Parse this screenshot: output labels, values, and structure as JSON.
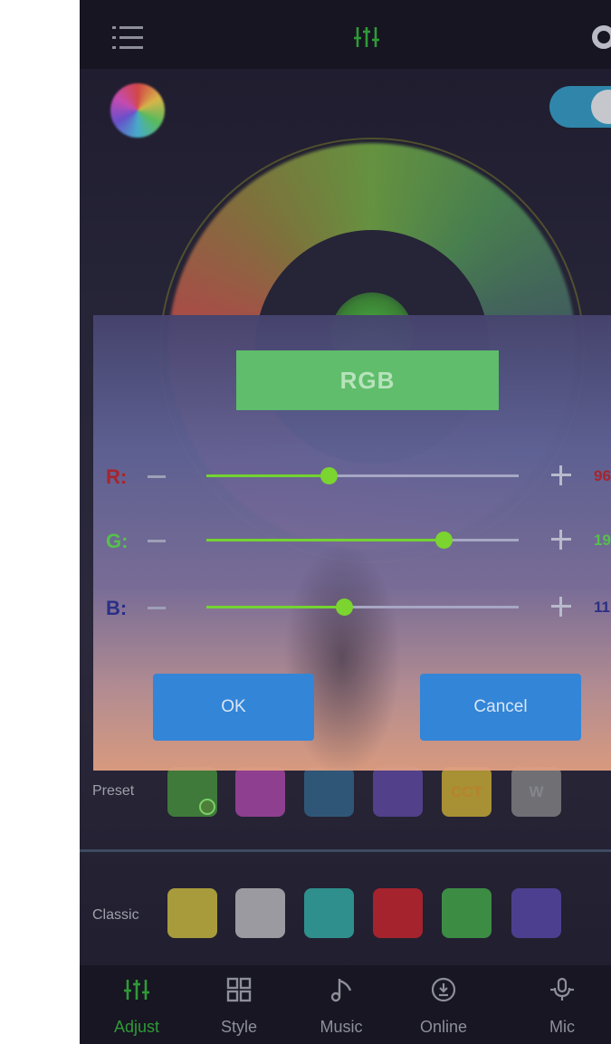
{
  "app": {
    "bottom_nav": [
      {
        "label": "Adjust",
        "active": true
      },
      {
        "label": "Style"
      },
      {
        "label": "Music"
      },
      {
        "label": "Online"
      },
      {
        "label": "Mic"
      }
    ],
    "rows": {
      "preset_label": "Preset",
      "classic_label": "Classic",
      "preset_swatches": [
        {
          "color": "#3f7a3a",
          "label": "",
          "selected": true
        },
        {
          "color": "#8e3f8f",
          "label": ""
        },
        {
          "color": "#305677",
          "label": ""
        },
        {
          "color": "#52408a",
          "label": ""
        },
        {
          "color": "#a89034",
          "label": "CCT",
          "text_color": "#b7832c"
        },
        {
          "color": "#6f6f74",
          "label": "W",
          "text_color": "#85868c"
        }
      ],
      "classic_swatches": [
        {
          "color": "#a79b3c"
        },
        {
          "color": "#9a9aa0"
        },
        {
          "color": "#2f8f8c"
        },
        {
          "color": "#a4232d"
        },
        {
          "color": "#3c8c44"
        },
        {
          "color": "#4d3f8f"
        }
      ]
    }
  },
  "dialog": {
    "title": "RGB",
    "channels": [
      {
        "label": "R:",
        "value": "96",
        "level": 0.39,
        "label_color": "#a8242c",
        "value_color": "#a8242c"
      },
      {
        "label": "G:",
        "value": "19",
        "level": 0.76,
        "label_color": "#54c24a",
        "value_color": "#54c24a"
      },
      {
        "label": "B:",
        "value": "11",
        "level": 0.44,
        "label_color": "#2a2f86",
        "value_color": "#2a2f86"
      }
    ],
    "ok_label": "OK",
    "cancel_label": "Cancel"
  },
  "colors": {
    "accent_green": "#2f9a37",
    "slider_green": "#74d330",
    "button_blue": "#3385d7"
  }
}
